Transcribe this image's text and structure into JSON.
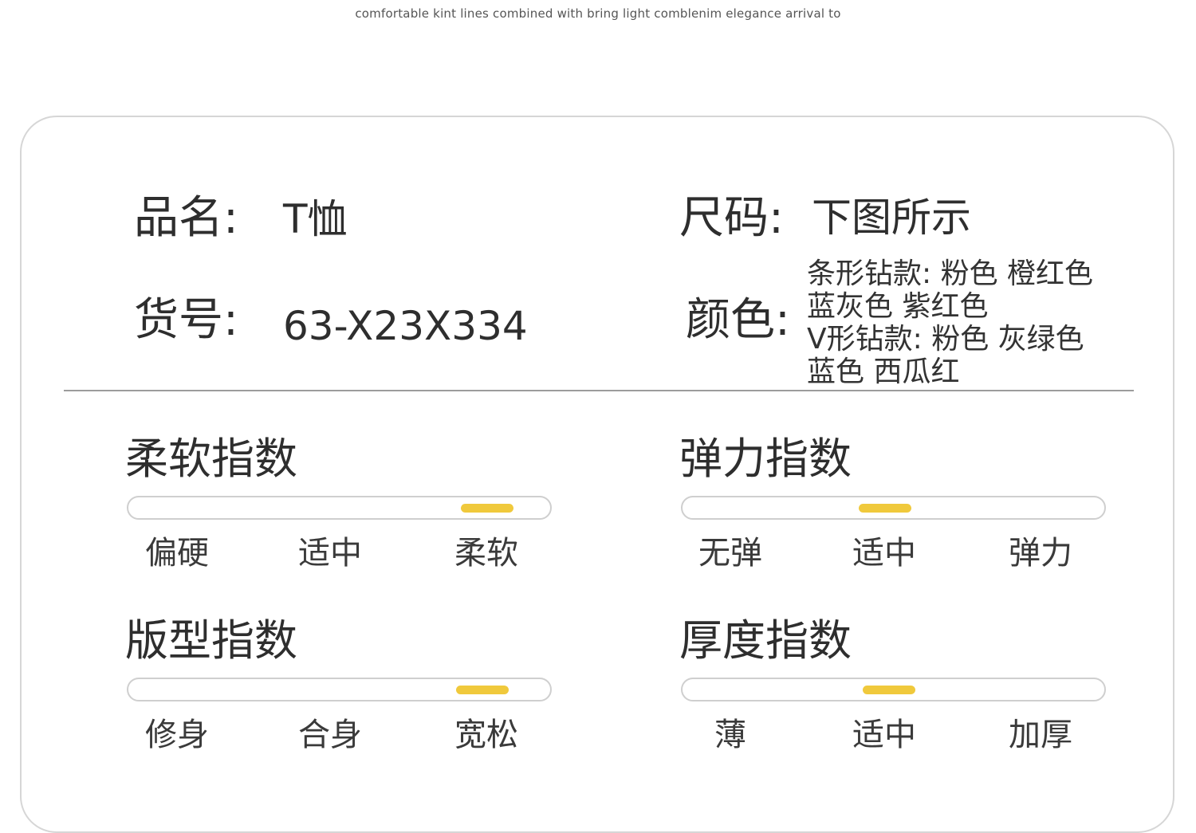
{
  "tagline": "comfortable kint lines combined with bring light comblenim elegance arrival to",
  "product": {
    "name_label": "品名:",
    "name_value": "T恤",
    "sku_label": "货号:",
    "sku_value": "63-X23X334",
    "size_label": "尺码:",
    "size_value": "下图所示",
    "color_label": "颜色:",
    "color_lines": [
      "条形钻款: 粉色 橙红色",
      "蓝灰色 紫红色",
      "V形钻款: 粉色 灰绿色",
      "蓝色 西瓜红"
    ]
  },
  "indices": [
    {
      "title": "柔软指数",
      "scale": [
        "偏硬",
        "适中",
        "柔软"
      ],
      "level": 0.85
    },
    {
      "title": "弹力指数",
      "scale": [
        "无弹",
        "适中",
        "弹力"
      ],
      "level": 0.48
    },
    {
      "title": "版型指数",
      "scale": [
        "修身",
        "合身",
        "宽松"
      ],
      "level": 0.84
    },
    {
      "title": "厚度指数",
      "scale": [
        "薄",
        "适中",
        "加厚"
      ],
      "level": 0.49
    }
  ],
  "colors": {
    "indicator": "#f0c93c",
    "track_border": "#cfcfcf",
    "card_border": "#d6d6d6"
  }
}
